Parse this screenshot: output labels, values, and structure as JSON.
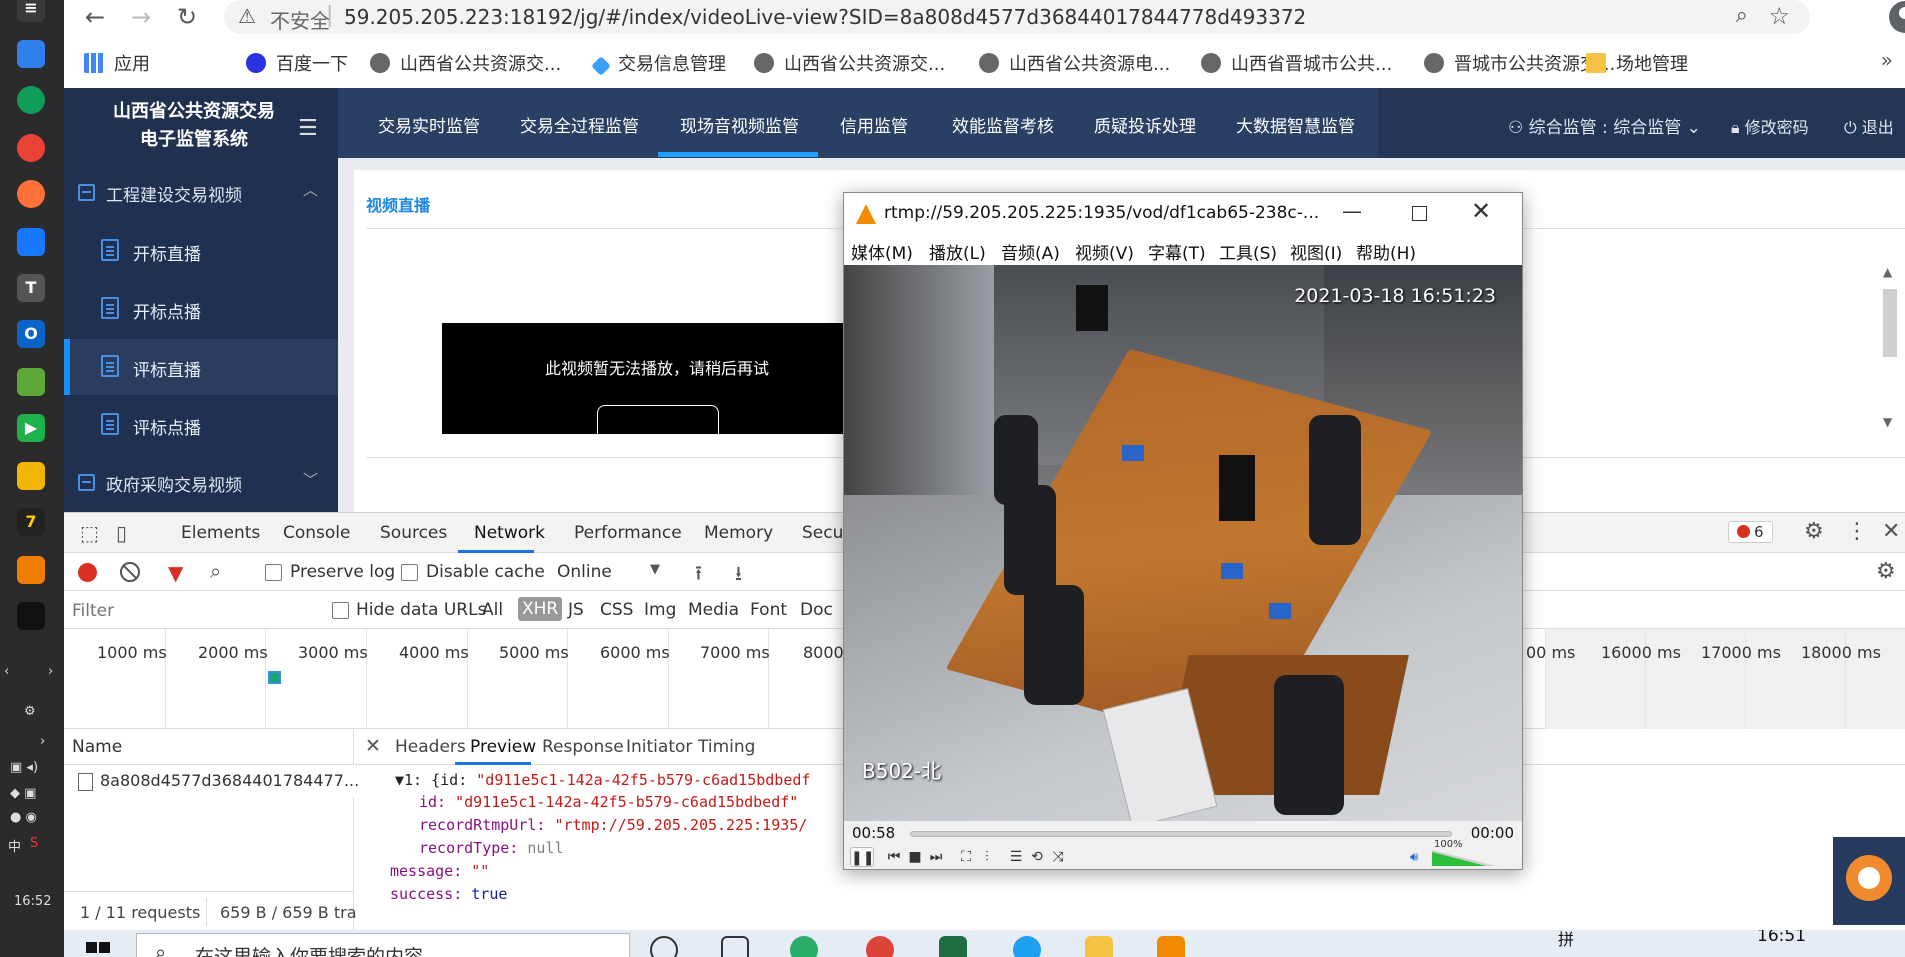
{
  "browser": {
    "url_warning_text": "不安全",
    "url": "59.205.205.223:18192/jg/#/index/videoLive-view?SID=8a808d4577d36844017844778d493372",
    "bookmarks": [
      "应用",
      "百度一下",
      "山西省公共资源交...",
      "交易信息管理",
      "山西省公共资源交...",
      "山西省公共资源电...",
      "山西省晋城市公共...",
      "晋城市公共资源交...",
      "场地管理"
    ]
  },
  "app": {
    "title_line1": "山西省公共资源交易",
    "title_line2": "电子监管系统",
    "sidebar": {
      "group1": "工程建设交易视频",
      "items": [
        "开标直播",
        "开标点播",
        "评标直播",
        "评标点播"
      ],
      "active_index": 2,
      "group2": "政府采购交易视频"
    },
    "topnav": {
      "items": [
        "交易实时监管",
        "交易全过程监管",
        "现场音视频监管",
        "信用监管",
        "效能监督考核",
        "质疑投诉处理",
        "大数据智慧监管"
      ],
      "active_index": 2,
      "user": "综合监管 : 综合监管",
      "change_password": "修改密码",
      "logout": "退出"
    },
    "content": {
      "card_title": "视频直播",
      "video_error": "此视频暂无法播放，请稍后再试"
    }
  },
  "devtools": {
    "tabs": [
      "Elements",
      "Console",
      "Sources",
      "Network",
      "Performance",
      "Memory",
      "Secur"
    ],
    "active_tab": "Network",
    "error_count": "6",
    "toolbar": {
      "preserve_log": "Preserve log",
      "disable_cache": "Disable cache",
      "throttle": "Online"
    },
    "filter": {
      "placeholder": "Filter",
      "hide_data_urls": "Hide data URLs",
      "types": [
        "All",
        "XHR",
        "JS",
        "CSS",
        "Img",
        "Media",
        "Font",
        "Doc"
      ],
      "active_type": "XHR"
    },
    "timeline_ticks": [
      "1000 ms",
      "2000 ms",
      "3000 ms",
      "4000 ms",
      "5000 ms",
      "6000 ms",
      "7000 ms",
      "8000",
      "00 ms",
      "16000 ms",
      "17000 ms",
      "18000 ms"
    ],
    "list": {
      "header": "Name",
      "request_name": "8a808d4577d3684401784477...",
      "requests_count": "1 / 11 requests",
      "transfer": "659 B / 659 B tra"
    },
    "detail": {
      "tabs": [
        "Headers",
        "Preview",
        "Response",
        "Initiator",
        "Timing"
      ],
      "active_tab": "Preview",
      "lines": {
        "l1_prefix": "▼1: {id: ",
        "l1_value": "\"d911e5c1-142a-42f5-b579-c6ad15bdbedf",
        "l2_key": "id: ",
        "l2_value": "\"d911e5c1-142a-42f5-b579-c6ad15bdbedf\"",
        "l3_key": "recordRtmpUrl: ",
        "l3_value": "\"rtmp://59.205.205.225:1935/",
        "l4_key": "recordType: ",
        "l4_value": "null",
        "l5_key": "message: ",
        "l5_value": "\"\"",
        "l6_key": "success: ",
        "l6_value": "true"
      }
    }
  },
  "vlc": {
    "title": "rtmp://59.205.205.225:1935/vod/df1cab65-238c-...",
    "menu": [
      "媒体(M)",
      "播放(L)",
      "音频(A)",
      "视频(V)",
      "字幕(T)",
      "工具(S)",
      "视图(I)",
      "帮助(H)"
    ],
    "osd_timestamp": "2021-03-18 16:51:23",
    "camera_label": "B502-北",
    "elapsed": "00:58",
    "total": "00:00",
    "volume_label": "100%"
  },
  "desktop": {
    "left_clock": "16:52",
    "left_ime": "中"
  },
  "taskbar": {
    "search_text": "在这里输入你要搜索的内容",
    "ime": "拼",
    "clock": "16:51"
  }
}
